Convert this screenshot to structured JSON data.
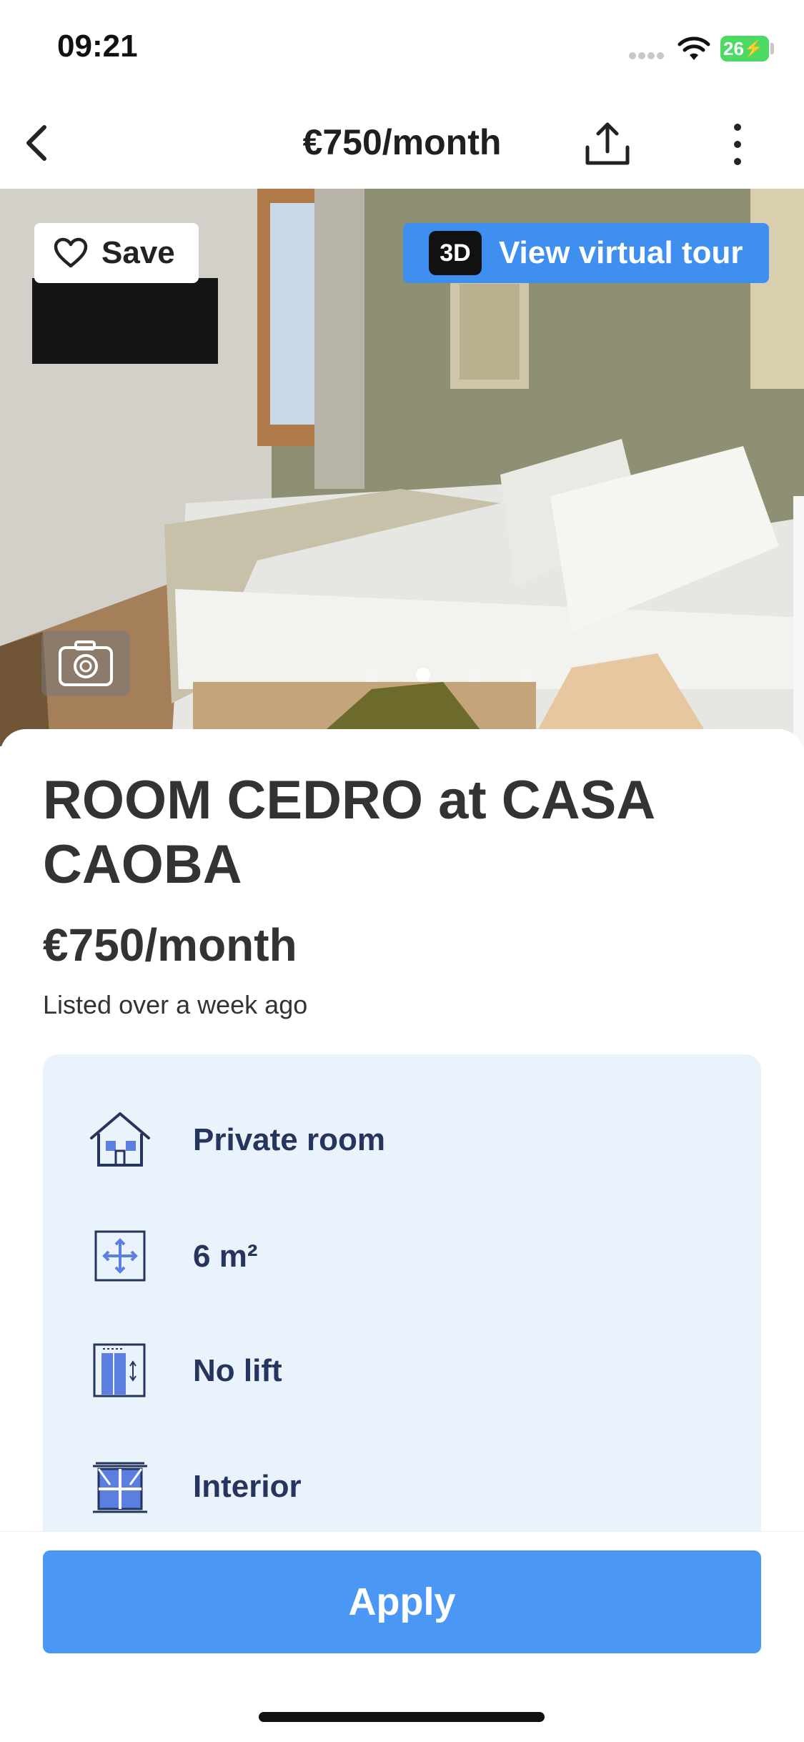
{
  "status_bar": {
    "time": "09:21",
    "battery": "26"
  },
  "nav": {
    "title": "€750/month"
  },
  "hero": {
    "save_label": "Save",
    "badge_3d": "3D",
    "tour_label": "View virtual tour",
    "carousel": {
      "count": 4,
      "active_index": 1
    }
  },
  "listing": {
    "title": "ROOM CEDRO at CASA CAOBA",
    "price": "€750/month",
    "listed": "Listed over a week ago"
  },
  "features": [
    {
      "icon": "house-icon",
      "label": "Private room"
    },
    {
      "icon": "area-icon",
      "label": "6 m²"
    },
    {
      "icon": "lift-icon",
      "label": "No lift"
    },
    {
      "icon": "window-icon",
      "label": "Interior"
    }
  ],
  "actions": {
    "apply_label": "Apply"
  },
  "colors": {
    "accent": "#4a97f5",
    "feature_bg": "#eaf3fc",
    "feature_text": "#25355d"
  }
}
